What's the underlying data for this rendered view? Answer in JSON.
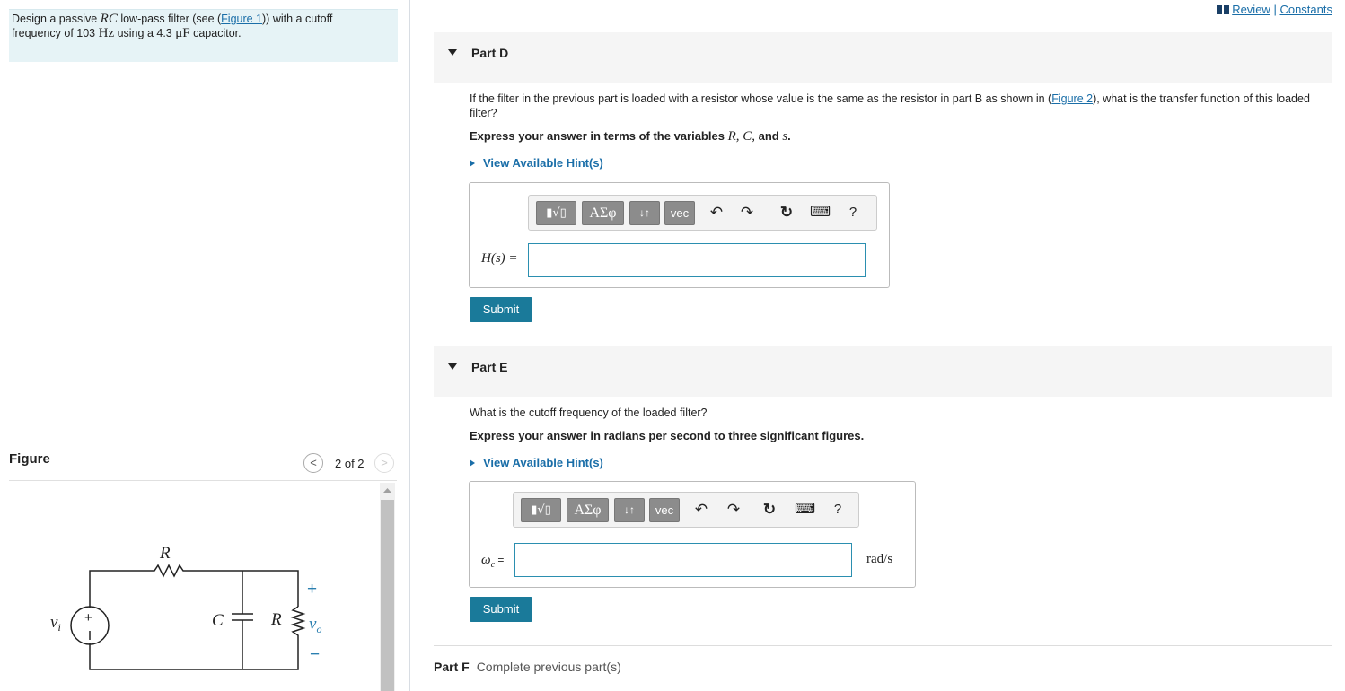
{
  "top_links": {
    "review": "Review",
    "separator": "|",
    "constants": "Constants"
  },
  "problem": {
    "text_1": "Design a passive ",
    "rc": "RC",
    "text_2": " low-pass filter (see (",
    "figure_link": "Figure 1",
    "text_3": ")) with a cutoff frequency of 103 ",
    "hz": "Hz",
    "text_4": " using a 4.3 ",
    "uf": "μF",
    "text_5": " capacitor."
  },
  "figure": {
    "title": "Figure",
    "prev": "<",
    "count": "2 of 2",
    "next": ">",
    "labels": {
      "r_top": "R",
      "c": "C",
      "r_right": "R",
      "vi": "v",
      "vi_sub": "i",
      "vo": "v",
      "vo_sub": "o",
      "plus": "+",
      "minus": "−",
      "src_plus": "+"
    }
  },
  "partD": {
    "label": "Part D",
    "question_1": "If the filter in the previous part is loaded with a resistor whose value is the same as the resistor in part B as shown in (",
    "figure_link": "Figure 2",
    "question_2": "), what is the transfer function of this loaded filter?",
    "express_1": "Express your answer in terms of the variables ",
    "vars": "R, C,",
    "express_and": " and ",
    "var_s": "s",
    "express_end": ".",
    "hint": "View Available Hint(s)",
    "eq_label": "H(s) =",
    "input_value": "",
    "submit": "Submit"
  },
  "partE": {
    "label": "Part E",
    "question": "What is the cutoff frequency of the loaded filter?",
    "express": "Express your answer in radians per second to three significant figures.",
    "hint": "View Available Hint(s)",
    "eq_label_1": "ω",
    "eq_label_sub": "c",
    "eq_label_2": " =",
    "input_value": "",
    "unit": "rad/s",
    "submit": "Submit"
  },
  "partF": {
    "label": "Part F",
    "desc": "Complete previous part(s)"
  },
  "toolbar": {
    "templates": "▮√▯",
    "greek": "ΑΣφ",
    "arrows": "↓↑",
    "vec": "vec",
    "undo": "↶",
    "redo": "↷",
    "reset": "↻",
    "keyboard": "⌨",
    "help": "?"
  },
  "colors": {
    "link": "#1a6ea8",
    "submit": "#1a7a9a",
    "problem_bg": "#e6f3f6",
    "input_border": "#2b8fb0"
  }
}
